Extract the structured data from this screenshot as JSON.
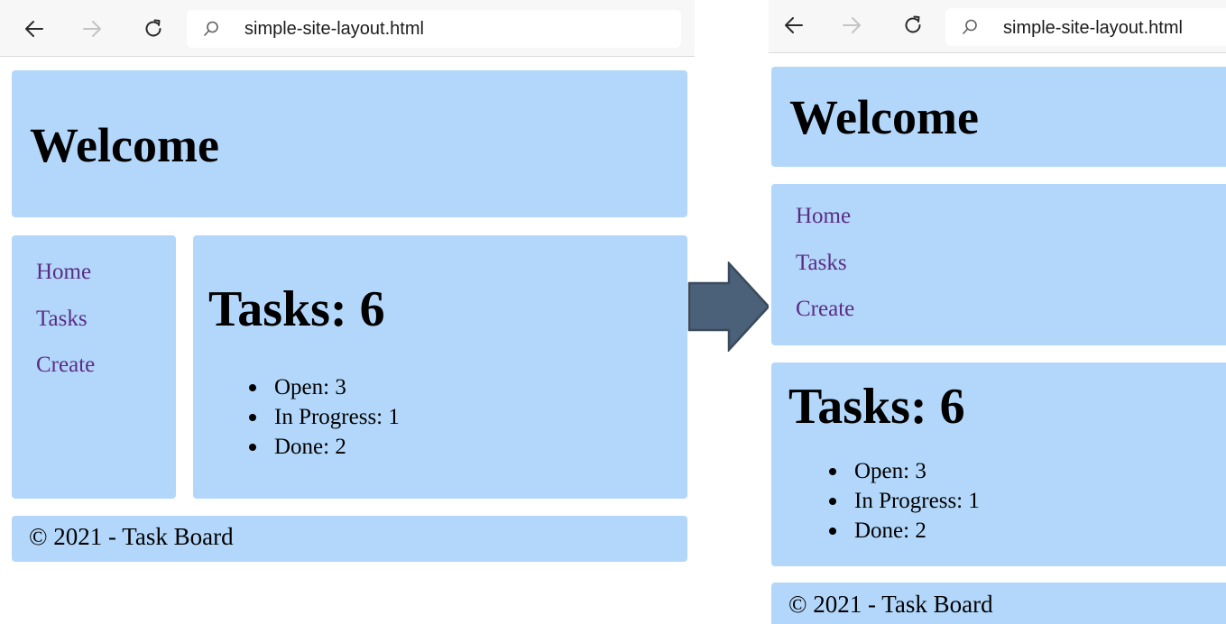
{
  "left_browser": {
    "url": "simple-site-layout.html",
    "title": "Welcome",
    "nav": [
      "Home",
      "Tasks",
      "Create"
    ],
    "tasks_heading": "Tasks: 6",
    "task_items": [
      "Open: 3",
      "In Progress: 1",
      "Done: 2"
    ],
    "footer": "© 2021 - Task Board"
  },
  "right_browser": {
    "url": "simple-site-layout.html",
    "title": "Welcome",
    "nav": [
      "Home",
      "Tasks",
      "Create"
    ],
    "tasks_heading": "Tasks: 6",
    "task_items": [
      "Open: 3",
      "In Progress: 1",
      "Done: 2"
    ],
    "footer": "© 2021 - Task Board"
  },
  "colors": {
    "box_background": "#b3d7fa",
    "link_color": "#5b2c86",
    "arrow_fill": "#4a6179",
    "arrow_stroke": "#3a4a5c"
  },
  "icons": {
    "back": "arrow-left-icon",
    "forward": "arrow-right-icon",
    "reload": "reload-icon",
    "search": "search-icon",
    "transition": "right-arrow-icon"
  }
}
